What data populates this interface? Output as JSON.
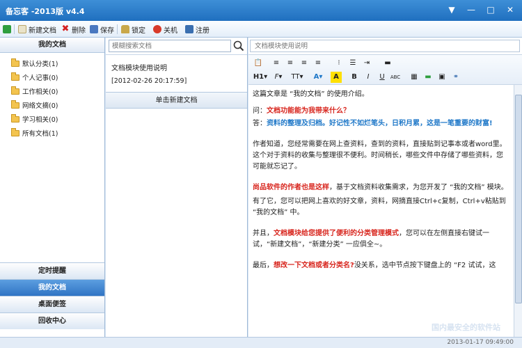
{
  "window": {
    "title": "备忘客 -2013版 v4.4",
    "controls": [
      "▼",
      "—",
      "□",
      "✕"
    ]
  },
  "toolbar": {
    "new_doc": "新建文档",
    "delete": "删除",
    "save": "保存",
    "lock": "锁定",
    "shutdown": "关机",
    "logout": "注册"
  },
  "left": {
    "header": "我的文档",
    "categories": [
      {
        "label": "默认分类(1)"
      },
      {
        "label": "个人记事(0)"
      },
      {
        "label": "工作相关(0)"
      },
      {
        "label": "网络文摘(0)"
      },
      {
        "label": "学习相关(0)"
      },
      {
        "label": "所有文档(1)"
      }
    ],
    "nav": [
      {
        "label": "定时提醒"
      },
      {
        "label": "我的文档"
      },
      {
        "label": "桌面便签"
      },
      {
        "label": "回收中心"
      }
    ]
  },
  "middle": {
    "search_placeholder": "模糊搜索文档",
    "doc_title": "文档模块使用说明",
    "doc_date": "[2012-02-26 20:17:59]",
    "new_doc_button": "单击新建文档"
  },
  "right": {
    "title_placeholder": "文档模块使用说明",
    "content": {
      "intro": "这篇文章是 “我的文档” 的使用介绍。",
      "q_prefix": "问：",
      "q_text": "文档功能能为我带来什么？",
      "a_prefix": "答：",
      "a_text": "资料的整理及归档。好记性不如烂笔头，日积月累，这是一笔重要的财富!",
      "p1": "作者知道，您经常需要在网上查资料，查到的资料，直接贴到记事本或者word里。这个对于资料的收集与整理很不便利。时间稍长，哪些文件中存储了哪些资料，您可能就忘记了。",
      "p2_red": "尚品软件的作者也是这样",
      "p2_rest": "，基于文档资料收集需求，为您开发了 “我的文档” 模块。",
      "p3": "有了它，您可以把网上喜欢的好文章，资料，网摘直接Ctrl+c复制，Ctrl+v粘贴到 “我的文档” 中。",
      "p4_a": "并且，",
      "p4_red": "文档模块给您提供了便利的分类管理模式",
      "p4_b": "，您可以在左侧直接右键试一试，“新建文档”，“新建分类” 一应俱全~。",
      "p5_a": "最后，",
      "p5_red": "想改一下文档或者分类名?",
      "p5_b": "没关系，选中节点按下键盘上的 “F2 试试，这"
    }
  },
  "status": {
    "time": "2013-01-17 09:49:00"
  },
  "watermark": "国内最安全的软件站",
  "colors": {
    "accent": "#1f6fbf",
    "active_nav": "#2f74c4",
    "red_text": "#d8261e",
    "blue_text": "#1f78c8"
  }
}
